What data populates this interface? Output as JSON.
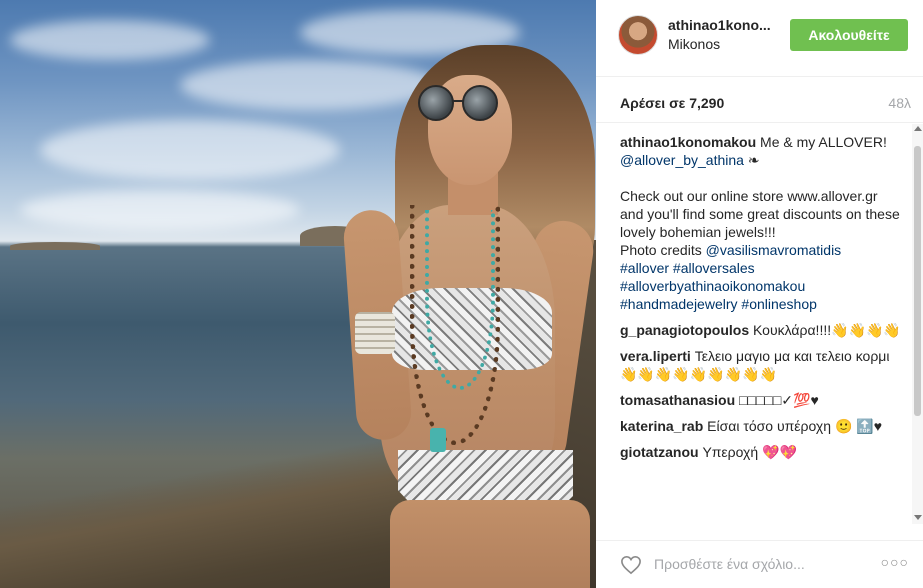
{
  "post": {
    "username": "athinao1kono...",
    "location": "Mikonos",
    "follow_label": "Ακολουθείτε",
    "likes": "Αρέσει σε 7,290",
    "time": "48λ",
    "add_comment_placeholder": "Προσθέστε ένα σχόλιο...",
    "more_label": "○○○"
  },
  "caption": {
    "user": "athinao1konomakou",
    "text1": "Me & my ALLOVER!",
    "mention": "@allover_by_athina",
    "emoji": "❧",
    "body": "Check out our online store www.allover.gr and you'll find some great discounts on these lovely bohemian jewels!!!",
    "credits_prefix": "Photo credits",
    "credits_mention": "@vasilismavromatidis",
    "hashtags": "#allover #alloversales #alloverbyathinaoikonomakou #handmadejewelry #onlineshop"
  },
  "comments": [
    {
      "user": "g_panagiotopoulos",
      "text": "Κουκλάρα!!!!👋👋👋👋"
    },
    {
      "user": "vera.liperti",
      "text": "Τελειο μαγιο μα και τελειο κορμι 👋👋👋👋👋👋👋👋👋"
    },
    {
      "user": "tomasathanasiou",
      "text": "□□□□□✓💯♥"
    },
    {
      "user": "katerina_rab",
      "text": "Είσαι τόσο υπέροχη 🙂 🔝♥"
    },
    {
      "user": "giotatzanou",
      "text": "Υπεροχή 💖💖"
    }
  ]
}
